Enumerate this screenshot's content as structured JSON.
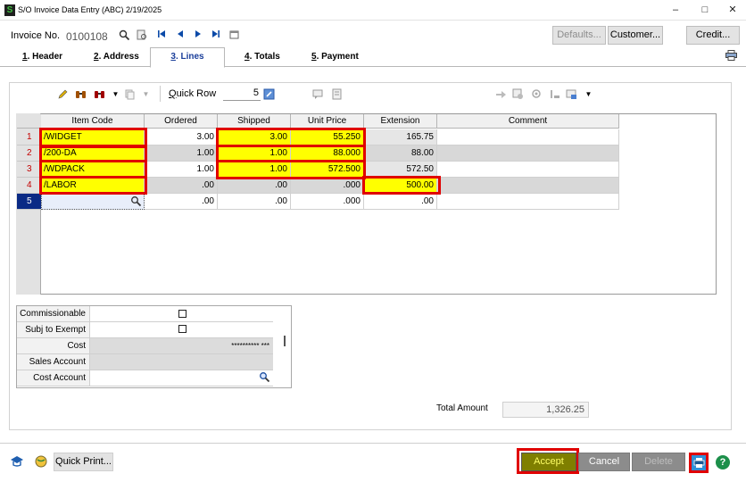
{
  "window": {
    "title": "S/O Invoice Data Entry (ABC) 2/19/2025",
    "app_icon": "S",
    "min": "–",
    "max": "□",
    "close": "✕"
  },
  "header": {
    "invoice_label": "Invoice No.",
    "invoice_value": "0100108",
    "defaults_label": "Defaults...",
    "customer_label": "Customer...",
    "credit_label": "Credit..."
  },
  "tabs": [
    {
      "num": "1",
      "label": ". Header"
    },
    {
      "num": "2",
      "label": ". Address"
    },
    {
      "num": "3",
      "label": ". Lines"
    },
    {
      "num": "4",
      "label": ". Totals"
    },
    {
      "num": "5",
      "label": ". Payment"
    }
  ],
  "grid_toolbar": {
    "quick_row_label": "Quick Row",
    "quick_row_value": "5"
  },
  "grid": {
    "columns": [
      "Item Code",
      "Ordered",
      "Shipped",
      "Unit Price",
      "Extension",
      "Comment"
    ],
    "rows": [
      {
        "num": "1",
        "item": "/WIDGET",
        "ordered": "3.00",
        "shipped": "3.00",
        "price": "55.250",
        "ext": "165.75",
        "comment": ""
      },
      {
        "num": "2",
        "item": "/200-DA",
        "ordered": "1.00",
        "shipped": "1.00",
        "price": "88.000",
        "ext": "88.00",
        "comment": ""
      },
      {
        "num": "3",
        "item": "/WDPACK",
        "ordered": "1.00",
        "shipped": "1.00",
        "price": "572.500",
        "ext": "572.50",
        "comment": ""
      },
      {
        "num": "4",
        "item": "/LABOR",
        "ordered": ".00",
        "shipped": ".00",
        "price": ".000",
        "ext": "500.00",
        "comment": ""
      },
      {
        "num": "5",
        "item": "",
        "ordered": ".00",
        "shipped": ".00",
        "price": ".000",
        "ext": ".00",
        "comment": ""
      }
    ]
  },
  "properties": {
    "commissionable": "Commissionable",
    "subj_exempt": "Subj to Exempt",
    "cost": "Cost",
    "cost_value": "********** ***",
    "sales_account": "Sales Account",
    "cost_account": "Cost Account"
  },
  "totals": {
    "label": "Total Amount",
    "value": "1,326.25"
  },
  "footer": {
    "quick_print": "Quick Print...",
    "accept": "Accept",
    "cancel": "Cancel",
    "delete": "Delete",
    "help": "?"
  },
  "colors": {
    "highlight_yellow": "#ffff00",
    "annotation_red": "#e00000",
    "current_row_blue": "#0a2a85",
    "accept_bg": "#7f7f00"
  }
}
